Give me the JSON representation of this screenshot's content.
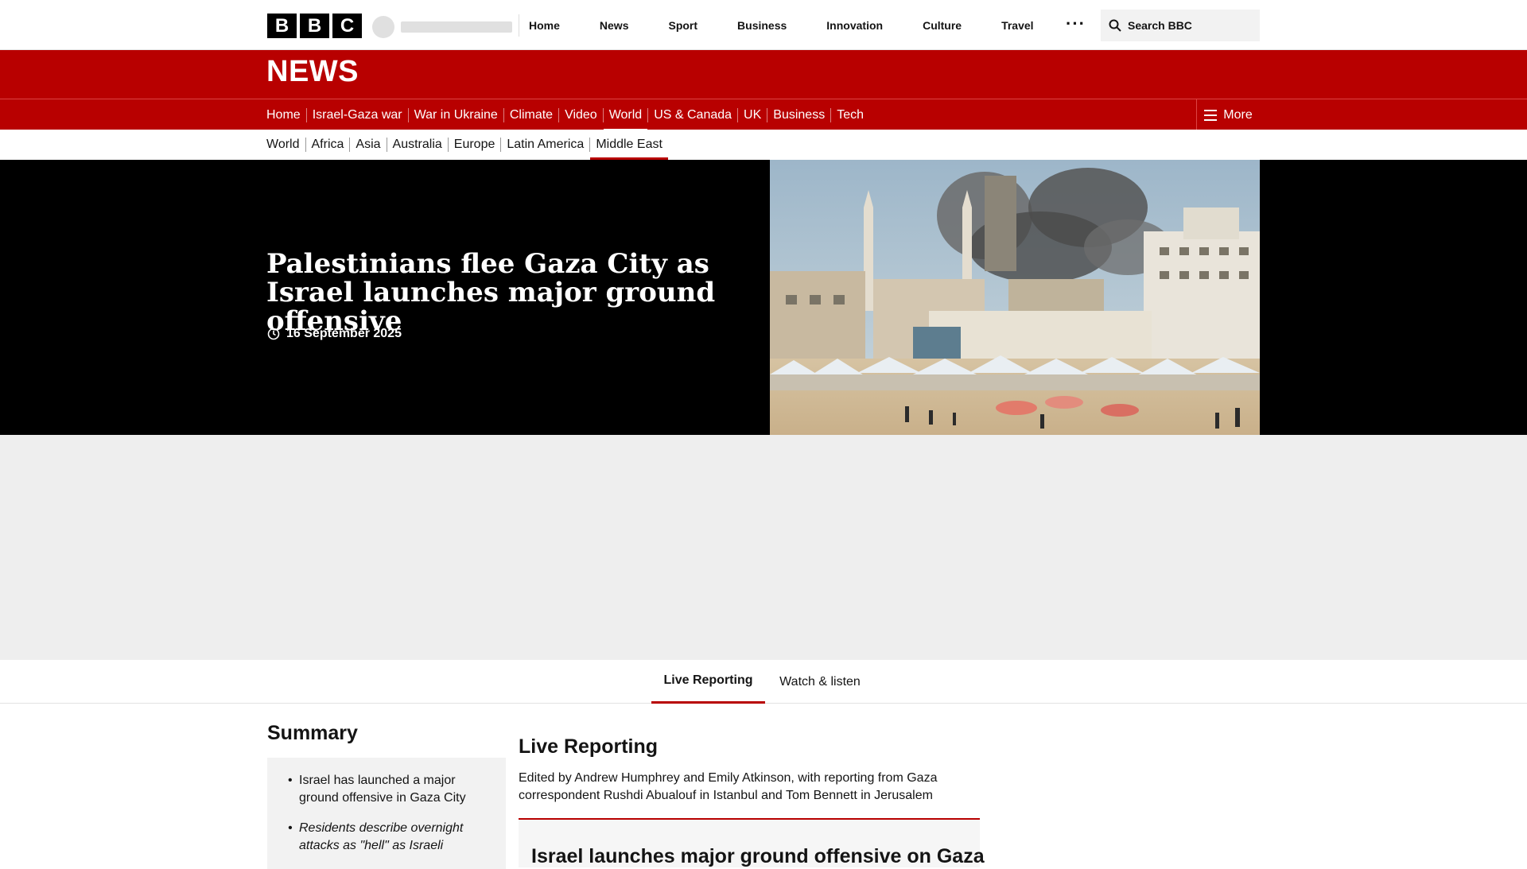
{
  "header": {
    "logo_letters": [
      "B",
      "B",
      "C"
    ],
    "nav": [
      "Home",
      "News",
      "Sport",
      "Business",
      "Innovation",
      "Culture",
      "Travel"
    ],
    "more_icon": "ellipsis-icon",
    "search_label": "Search BBC"
  },
  "news_header": {
    "wordmark": "NEWS",
    "nav": [
      {
        "label": "Home",
        "active": false
      },
      {
        "label": "Israel-Gaza war",
        "active": false
      },
      {
        "label": "War in Ukraine",
        "active": false
      },
      {
        "label": "Climate",
        "active": false
      },
      {
        "label": "Video",
        "active": false
      },
      {
        "label": "World",
        "active": true
      },
      {
        "label": "US & Canada",
        "active": false
      },
      {
        "label": "UK",
        "active": false
      },
      {
        "label": "Business",
        "active": false
      },
      {
        "label": "Tech",
        "active": false
      }
    ],
    "more_label": "More"
  },
  "sub_nav": [
    {
      "label": "World",
      "active": false
    },
    {
      "label": "Africa",
      "active": false
    },
    {
      "label": "Asia",
      "active": false
    },
    {
      "label": "Australia",
      "active": false
    },
    {
      "label": "Europe",
      "active": false
    },
    {
      "label": "Latin America",
      "active": false
    },
    {
      "label": "Middle East",
      "active": true
    }
  ],
  "hero": {
    "title": "Palestinians flee Gaza City as Israel launches major ground offensive",
    "date": "16 September 2025"
  },
  "tabs": [
    {
      "label": "Live Reporting",
      "active": true
    },
    {
      "label": "Watch & listen",
      "active": false
    }
  ],
  "summary": {
    "title": "Summary",
    "items": [
      {
        "text": "Israel has launched a major ground offensive in Gaza City",
        "italic": false
      },
      {
        "text": "Residents describe overnight attacks as \"hell\" as Israeli",
        "italic": true
      }
    ]
  },
  "live": {
    "title": "Live Reporting",
    "credits": "Edited by Andrew Humphrey and Emily Atkinson, with reporting from Gaza correspondent Rushdi Abualouf in Istanbul and Tom Bennett in Jerusalem",
    "first_post_title": "Israel launches major ground offensive on Gaza"
  },
  "colors": {
    "brand_red": "#b80000",
    "black": "#000000",
    "ad_gray": "#eeeeee"
  }
}
